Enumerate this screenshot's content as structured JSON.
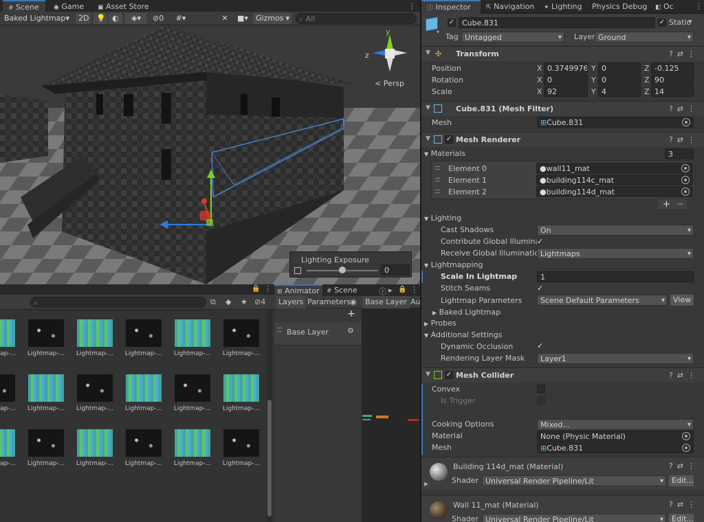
{
  "scene_tabs": {
    "scene": "Scene",
    "game": "Game",
    "asset_store": "Asset Store"
  },
  "scene_toolbar": {
    "draw_mode": "Baked Lightmap",
    "mode_2d": "2D",
    "hidden_count": "0",
    "gizmos": "Gizmos",
    "search_placeholder": "All"
  },
  "scene_view": {
    "persp_label": "< Persp",
    "gizmo_axes": {
      "y": "y",
      "z": "z"
    },
    "lighting_exposure": {
      "title": "Lighting Exposure",
      "value": "0",
      "slider_fraction": 0.5
    }
  },
  "project": {
    "hidden_count": "4",
    "thumb_label": "Lightmap-...",
    "rows": 3,
    "cols": 6
  },
  "animator": {
    "tab_animator": "Animator",
    "tab_scene": "Scene",
    "sub_layers": "Layers",
    "sub_parameters": "Parameters",
    "breadcrumb": "Base Layer",
    "cut_tab": "Au",
    "layer_item": "Base Layer"
  },
  "inspector": {
    "tabs": [
      "Inspector",
      "Navigation",
      "Lighting",
      "Physics Debug",
      "Oc"
    ],
    "object_name": "Cube.831",
    "static_label": "Static",
    "tag_label": "Tag",
    "tag_value": "Untagged",
    "layer_label": "Layer",
    "layer_value": "Ground",
    "transform": {
      "title": "Transform",
      "rows": [
        {
          "label": "Position",
          "x": "0.3749976",
          "y": "0",
          "z": "-0.125"
        },
        {
          "label": "Rotation",
          "x": "0",
          "y": "0",
          "z": "90"
        },
        {
          "label": "Scale",
          "x": "92",
          "y": "4",
          "z": "14"
        }
      ],
      "axis_x": "X",
      "axis_y": "Y",
      "axis_z": "Z"
    },
    "mesh_filter": {
      "title": "Cube.831 (Mesh Filter)",
      "mesh_label": "Mesh",
      "mesh_value": "Cube.831"
    },
    "mesh_renderer": {
      "title": "Mesh Renderer",
      "materials_label": "Materials",
      "materials_count": "3",
      "elements": [
        {
          "label": "Element 0",
          "value": "wall11_mat"
        },
        {
          "label": "Element 1",
          "value": "building114c_mat"
        },
        {
          "label": "Element 2",
          "value": "building114d_mat"
        }
      ],
      "lighting_label": "Lighting",
      "cast_shadows_label": "Cast Shadows",
      "cast_shadows_value": "On",
      "contribute_gi_label": "Contribute Global Illumination",
      "receive_gi_label": "Receive Global Illumination",
      "receive_gi_value": "Lightmaps",
      "lightmapping_label": "Lightmapping",
      "scale_lightmap_label": "Scale In Lightmap",
      "scale_lightmap_value": "1",
      "stitch_seams_label": "Stitch Seams",
      "lightmap_params_label": "Lightmap Parameters",
      "lightmap_params_value": "Scene Default Parameters",
      "view_button": "View",
      "baked_lightmap_label": "Baked Lightmap",
      "probes_label": "Probes",
      "additional_label": "Additional Settings",
      "dynamic_occlusion_label": "Dynamic Occlusion",
      "rendering_layer_label": "Rendering Layer Mask",
      "rendering_layer_value": "Layer1"
    },
    "mesh_collider": {
      "title": "Mesh Collider",
      "convex_label": "Convex",
      "is_trigger_label": "Is Trigger",
      "cooking_label": "Cooking Options",
      "cooking_value": "Mixed...",
      "material_label": "Material",
      "material_value": "None (Physic Material)",
      "mesh_label": "Mesh",
      "mesh_value": "Cube.831"
    },
    "materials": [
      {
        "title": "Building 114d_mat (Material)",
        "shader_label": "Shader",
        "shader_value": "Universal Render Pipeline/Lit",
        "edit": "Edit..."
      },
      {
        "title": "Wall 11_mat (Material)",
        "shader_label": "Shader",
        "shader_value": "Universal Render Pipeline/Lit",
        "edit": "Edit..."
      }
    ]
  },
  "colors": {
    "accent": "#3a79bb",
    "panel": "#383838",
    "header": "#3e3e3e",
    "field": "#2a2a2a",
    "axis_x": "#e0392b",
    "axis_y": "#7ed321",
    "axis_z": "#2f7ce0"
  }
}
